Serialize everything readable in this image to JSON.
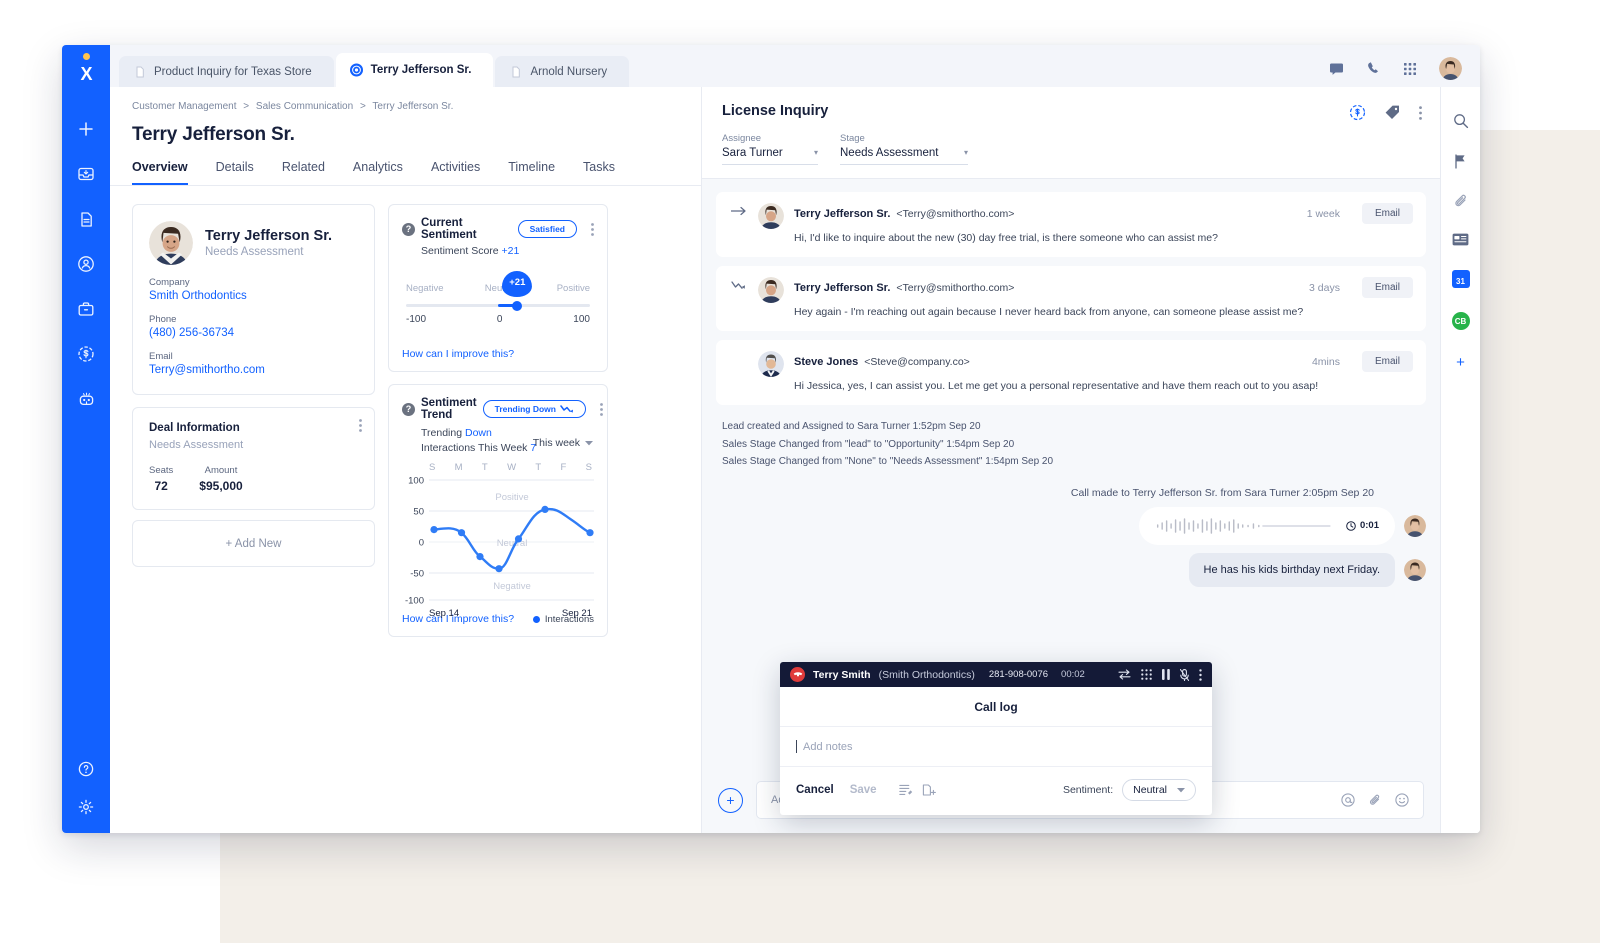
{
  "tabs": [
    {
      "label": "Product Inquiry for Texas Store",
      "icon": "file-icon",
      "active": false
    },
    {
      "label": "Terry Jefferson Sr.",
      "icon": "contact-circle-icon",
      "active": true
    },
    {
      "label": "Arnold Nursery",
      "icon": "file-icon",
      "active": false
    }
  ],
  "topbar_icons": [
    "chat-icon",
    "phone-icon",
    "apps-grid-icon",
    "user-avatar"
  ],
  "sidebar": {
    "logo": "x-logo",
    "items": [
      {
        "name": "add-icon"
      },
      {
        "name": "inbox-icon"
      },
      {
        "name": "document-icon"
      },
      {
        "name": "contact-icon"
      },
      {
        "name": "briefcase-icon"
      },
      {
        "name": "deals-dollar-icon"
      },
      {
        "name": "bot-icon"
      }
    ],
    "bottom": [
      {
        "name": "help-icon"
      },
      {
        "name": "settings-gear-icon"
      }
    ]
  },
  "breadcrumb": {
    "items": [
      "Customer Management",
      "Sales Communication",
      "Terry Jefferson Sr."
    ],
    "separator": ">"
  },
  "page_title": "Terry Jefferson Sr.",
  "subtabs": [
    {
      "label": "Overview",
      "active": true
    },
    {
      "label": "Details",
      "active": false
    },
    {
      "label": "Related",
      "active": false
    },
    {
      "label": "Analytics",
      "active": false
    },
    {
      "label": "Activities",
      "active": false
    },
    {
      "label": "Timeline",
      "active": false
    },
    {
      "label": "Tasks",
      "active": false
    }
  ],
  "profile": {
    "name": "Terry Jefferson Sr.",
    "stage": "Needs Assessment",
    "fields": [
      {
        "label": "Company",
        "value": "Smith Orthodontics"
      },
      {
        "label": "Phone",
        "value": "(480) 256-36734"
      },
      {
        "label": "Email",
        "value": "Terry@smithortho.com"
      }
    ]
  },
  "deal": {
    "title": "Deal Information",
    "stage": "Needs Assessment",
    "stats": [
      {
        "label": "Seats",
        "value": "72"
      },
      {
        "label": "Amount",
        "value": "$95,000"
      }
    ],
    "add_new": "+ Add New"
  },
  "current_sentiment": {
    "title": "Current Sentiment",
    "badge": "Satisfied",
    "score_label": "Sentiment Score",
    "score_value": "+21",
    "scale_labels": [
      "Negative",
      "Neutral",
      "Positive"
    ],
    "scale_numbers": [
      "-100",
      "0",
      "100"
    ],
    "bubble": "+21",
    "improve_link": "How can I improve this?"
  },
  "sentiment_trend": {
    "title": "Sentiment Trend",
    "badge": "Trending Down",
    "trending_label": "Trending",
    "trending_value": "Down",
    "interactions_label": "Interactions This Week",
    "interactions_value": "7",
    "range_selector": "This week",
    "improve_link": "How can I improve this?",
    "legend": "Interactions"
  },
  "chart_data": {
    "type": "line",
    "title": "Sentiment Trend",
    "x": [
      "S",
      "M",
      "T",
      "W",
      "T",
      "F",
      "S"
    ],
    "categories": [
      "S",
      "M",
      "T",
      "W",
      "T",
      "F",
      "S"
    ],
    "values": [
      20,
      15,
      -15,
      -43,
      5,
      51,
      15
    ],
    "series": [
      {
        "name": "Interactions",
        "values": [
          20,
          15,
          -15,
          -43,
          5,
          51,
          15
        ],
        "color": "#1261ff"
      }
    ],
    "ylim": [
      -100,
      100
    ],
    "yticks": [
      -100,
      -50,
      0,
      50,
      100
    ],
    "xlabel": "",
    "ylabel": "",
    "x_range_labels": [
      "Sep 14",
      "Sep 21"
    ],
    "band_labels": [
      "Positive",
      "Neutral",
      "Negative"
    ],
    "grid": true,
    "legend_position": "bottom-right"
  },
  "inquiry": {
    "title": "License Inquiry",
    "header_icons": [
      "deal-dollar-icon",
      "tag-icon",
      "more-vertical-icon"
    ],
    "selects": [
      {
        "label": "Assignee",
        "value": "Sara Turner"
      },
      {
        "label": "Stage",
        "value": "Needs Assessment"
      }
    ]
  },
  "messages": [
    {
      "direction_icon": "arrow-right-icon",
      "name": "Terry Jefferson Sr.",
      "email": "<Terry@smithortho.com>",
      "time": "1 week",
      "tag": "Email",
      "text": "Hi, I'd like to inquire about the new (30) day free trial, is there someone who can assist me?"
    },
    {
      "direction_icon": "trend-down-icon",
      "name": "Terry Jefferson Sr.",
      "email": "<Terry@smithortho.com>",
      "time": "3 days",
      "tag": "Email",
      "text": "Hey again - I'm reaching out again because I never heard back from anyone, can someone please assist me?"
    },
    {
      "direction_icon": "",
      "name": "Steve Jones",
      "email": "<Steve@company.co>",
      "time": "4mins",
      "tag": "Email",
      "text": "Hi Jessica, yes, I can assist you.  Let me get you a personal representative and have them reach out to you asap!"
    }
  ],
  "system_events": [
    "Lead created and Assigned to Sara Turner 1:52pm Sep 20",
    "Sales Stage Changed from \"lead\" to \"Opportunity\" 1:54pm Sep 20",
    "Sales Stage Changed from \"None\" to \"Needs Assessment\" 1:54pm Sep 20"
  ],
  "call_note": "Call made to Terry Jefferson Sr. from Sara Turner 2:05pm Sep 20",
  "voice_message": {
    "duration": "0:01",
    "icon": "clock-icon"
  },
  "text_bubble": "He has his kids birthday next Friday.",
  "composer": {
    "placeholder": "Add a note...",
    "plus": "+",
    "icons": [
      "mention-icon",
      "attachment-icon",
      "emoji-icon"
    ]
  },
  "right_rail": [
    {
      "name": "search-icon"
    },
    {
      "name": "flag-icon"
    },
    {
      "name": "paperclip-icon"
    },
    {
      "name": "card-icon"
    },
    {
      "name": "calendar-icon",
      "label": "31"
    },
    {
      "name": "integration-badge-icon",
      "label": "CB"
    },
    {
      "name": "add-widget-icon",
      "label": "+"
    }
  ],
  "call_dialog": {
    "contact": "Terry Smith",
    "company": "(Smith Orthodontics)",
    "phone": "281-908-0076",
    "duration": "00:02",
    "controls": [
      "transfer-icon",
      "keypad-icon",
      "pause-icon",
      "mute-icon",
      "more-vertical-icon"
    ],
    "title": "Call log",
    "notes_placeholder": "Add notes",
    "cancel": "Cancel",
    "save": "Save",
    "foot_icons": [
      "template-icon",
      "add-file-icon"
    ],
    "sentiment_label": "Sentiment:",
    "sentiment_value": "Neutral"
  },
  "colors": {
    "accent": "#1261ff",
    "rail": "#1261ff",
    "dark": "#141a37",
    "danger": "#e03b3b",
    "green": "#27b34a",
    "canvas": "#f3efe9"
  }
}
